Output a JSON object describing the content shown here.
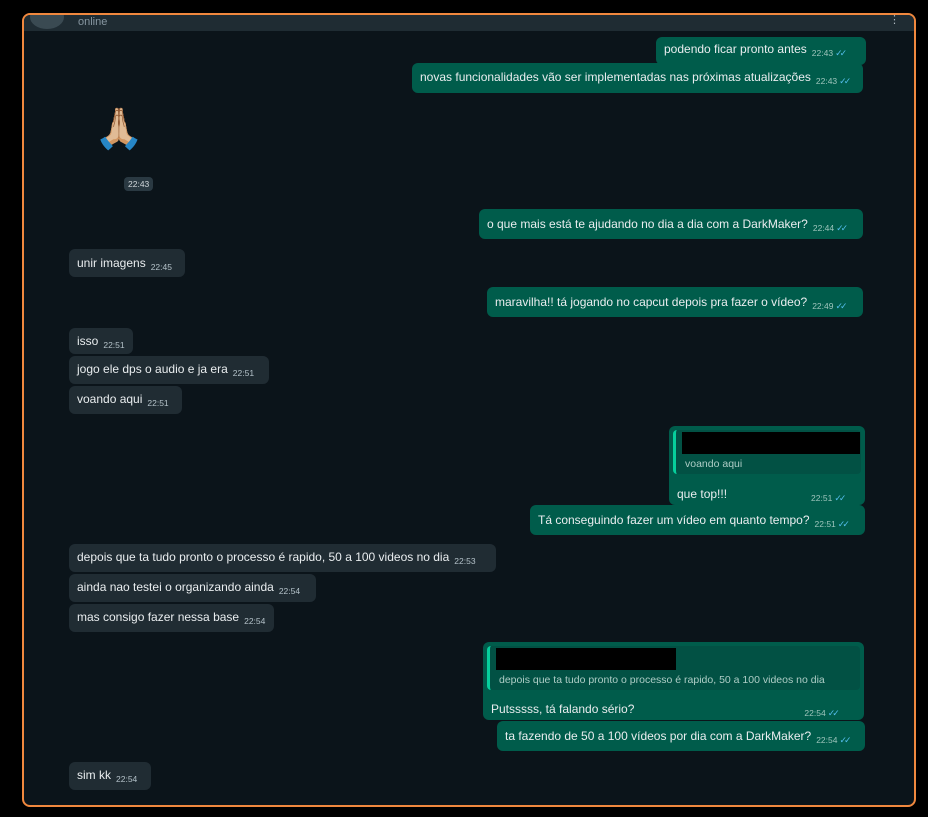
{
  "header": {
    "status": "online"
  },
  "messages": {
    "m1": {
      "text": "podendo ficar pronto antes",
      "time": "22:43"
    },
    "m2": {
      "text": "novas funcionalidades vão ser implementadas nas próximas atualizações",
      "time": "22:43"
    },
    "m3": {
      "emoji": "🙏🏼",
      "time": "22:43"
    },
    "m4": {
      "text": "o que mais está te ajudando no dia a dia com a DarkMaker?",
      "time": "22:44"
    },
    "m5": {
      "text": "unir imagens",
      "time": "22:45"
    },
    "m6": {
      "text": "maravilha!! tá jogando no capcut depois pra fazer o vídeo?",
      "time": "22:49"
    },
    "m7": {
      "text": "isso",
      "time": "22:51"
    },
    "m8": {
      "text": "jogo ele dps o audio e ja era",
      "time": "22:51"
    },
    "m9": {
      "text": "voando aqui",
      "time": "22:51"
    },
    "m10": {
      "quote": "voando aqui",
      "text": "que top!!!",
      "time": "22:51"
    },
    "m11": {
      "text": "Tá conseguindo fazer um vídeo em quanto tempo?",
      "time": "22:51"
    },
    "m12": {
      "text": "depois que ta tudo pronto o processo é rapido, 50 a 100 videos no dia",
      "time": "22:53"
    },
    "m13": {
      "text": "ainda nao testei o organizando ainda",
      "time": "22:54"
    },
    "m14": {
      "text": "mas consigo fazer nessa base",
      "time": "22:54"
    },
    "m15": {
      "quote": "depois que ta tudo pronto o processo é rapido, 50 a 100 videos no dia",
      "text": "Putsssss, tá falando sério?",
      "time": "22:54"
    },
    "m16": {
      "text": "ta fazendo de 50 a 100 vídeos por dia com a DarkMaker?",
      "time": "22:54"
    },
    "m17": {
      "text": "sim kk",
      "time": "22:54"
    }
  },
  "colors": {
    "background": "#0b141a",
    "incoming": "#202c33",
    "outgoing": "#005c4b",
    "read_ticks": "#53bdeb",
    "frame_border": "#f0883e"
  },
  "icons": {
    "read_receipt": "double-check-icon"
  }
}
